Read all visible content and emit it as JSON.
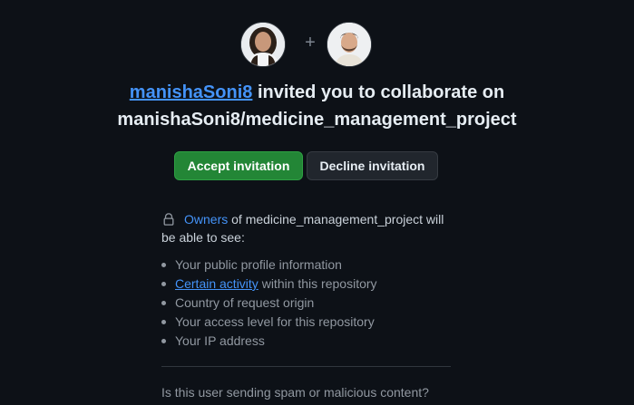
{
  "avatars": {
    "inviter_alt": "manishaSoni8",
    "plus_symbol": "+",
    "invitee_alt": "invitee"
  },
  "headline": {
    "inviter": "manishaSoni8",
    "text": " invited you to collaborate on",
    "repository": "manishaSoni8/medicine_management_project"
  },
  "actions": {
    "accept_label": "Accept invitation",
    "decline_label": "Decline invitation"
  },
  "visibility_notice": {
    "icon": "lock-icon",
    "owners_link": "Owners",
    "text": " of medicine_management_project will be able to see:"
  },
  "permissions": {
    "items": [
      {
        "text": "Your public profile information"
      },
      {
        "link": "Certain activity",
        "text": " within this repository"
      },
      {
        "text": "Country of request origin"
      },
      {
        "text": "Your access level for this repository"
      },
      {
        "text": "Your IP address"
      }
    ]
  },
  "report": {
    "question": "Is this user sending spam or malicious content?"
  },
  "colors": {
    "background": "#0d1117",
    "accent_link": "#4493f8",
    "accept_button": "#238636",
    "decline_button": "#21262d"
  }
}
